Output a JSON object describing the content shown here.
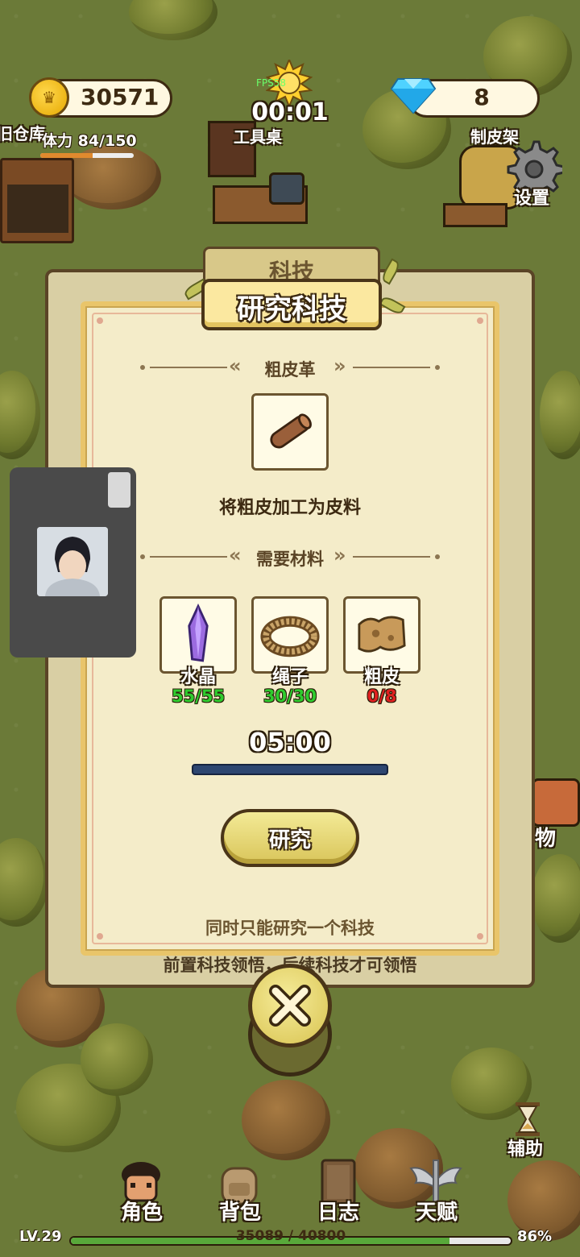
{
  "hud": {
    "coins": "30571",
    "gems": "8",
    "timer": "00:01",
    "fps": "FPS58",
    "stamina": "体力 84/150",
    "stamina_fraction": 0.56
  },
  "world_labels": {
    "warehouse": "旧仓库",
    "workbench": "工具桌",
    "tanning_rack": "制皮架",
    "settings": "设置",
    "items_partial": "物",
    "assist": "辅助"
  },
  "panel": {
    "tab_label": "科技",
    "title": "研究科技",
    "tech_name": "粗皮革",
    "tech_icon": "leather-roll-icon",
    "description": "将粗皮加工为皮料",
    "materials_title": "需要材料",
    "materials": [
      {
        "name": "水晶",
        "count": "55/55",
        "icon": "crystal-icon",
        "color": "#2ecc2e"
      },
      {
        "name": "绳子",
        "count": "30/30",
        "icon": "rope-icon",
        "color": "#2ecc2e"
      },
      {
        "name": "粗皮",
        "count": "0/8",
        "icon": "raw-hide-icon",
        "color": "#e02020"
      }
    ],
    "duration": "05:00",
    "progress_fraction": 0.0,
    "research_button": "研究",
    "note": "同时只能研究一个科技",
    "note_behind": "前置科技领悟，后续科技才可领悟"
  },
  "nav": {
    "items": [
      {
        "label": "角色",
        "icon": "character-icon"
      },
      {
        "label": "背包",
        "icon": "backpack-icon"
      },
      {
        "label": "日志",
        "icon": "journal-icon"
      },
      {
        "label": "天赋",
        "icon": "talent-wings-icon"
      }
    ],
    "level": "LV.29",
    "xp": "35089 / 40800",
    "xp_fraction": 0.86,
    "xp_percent": "86%"
  }
}
